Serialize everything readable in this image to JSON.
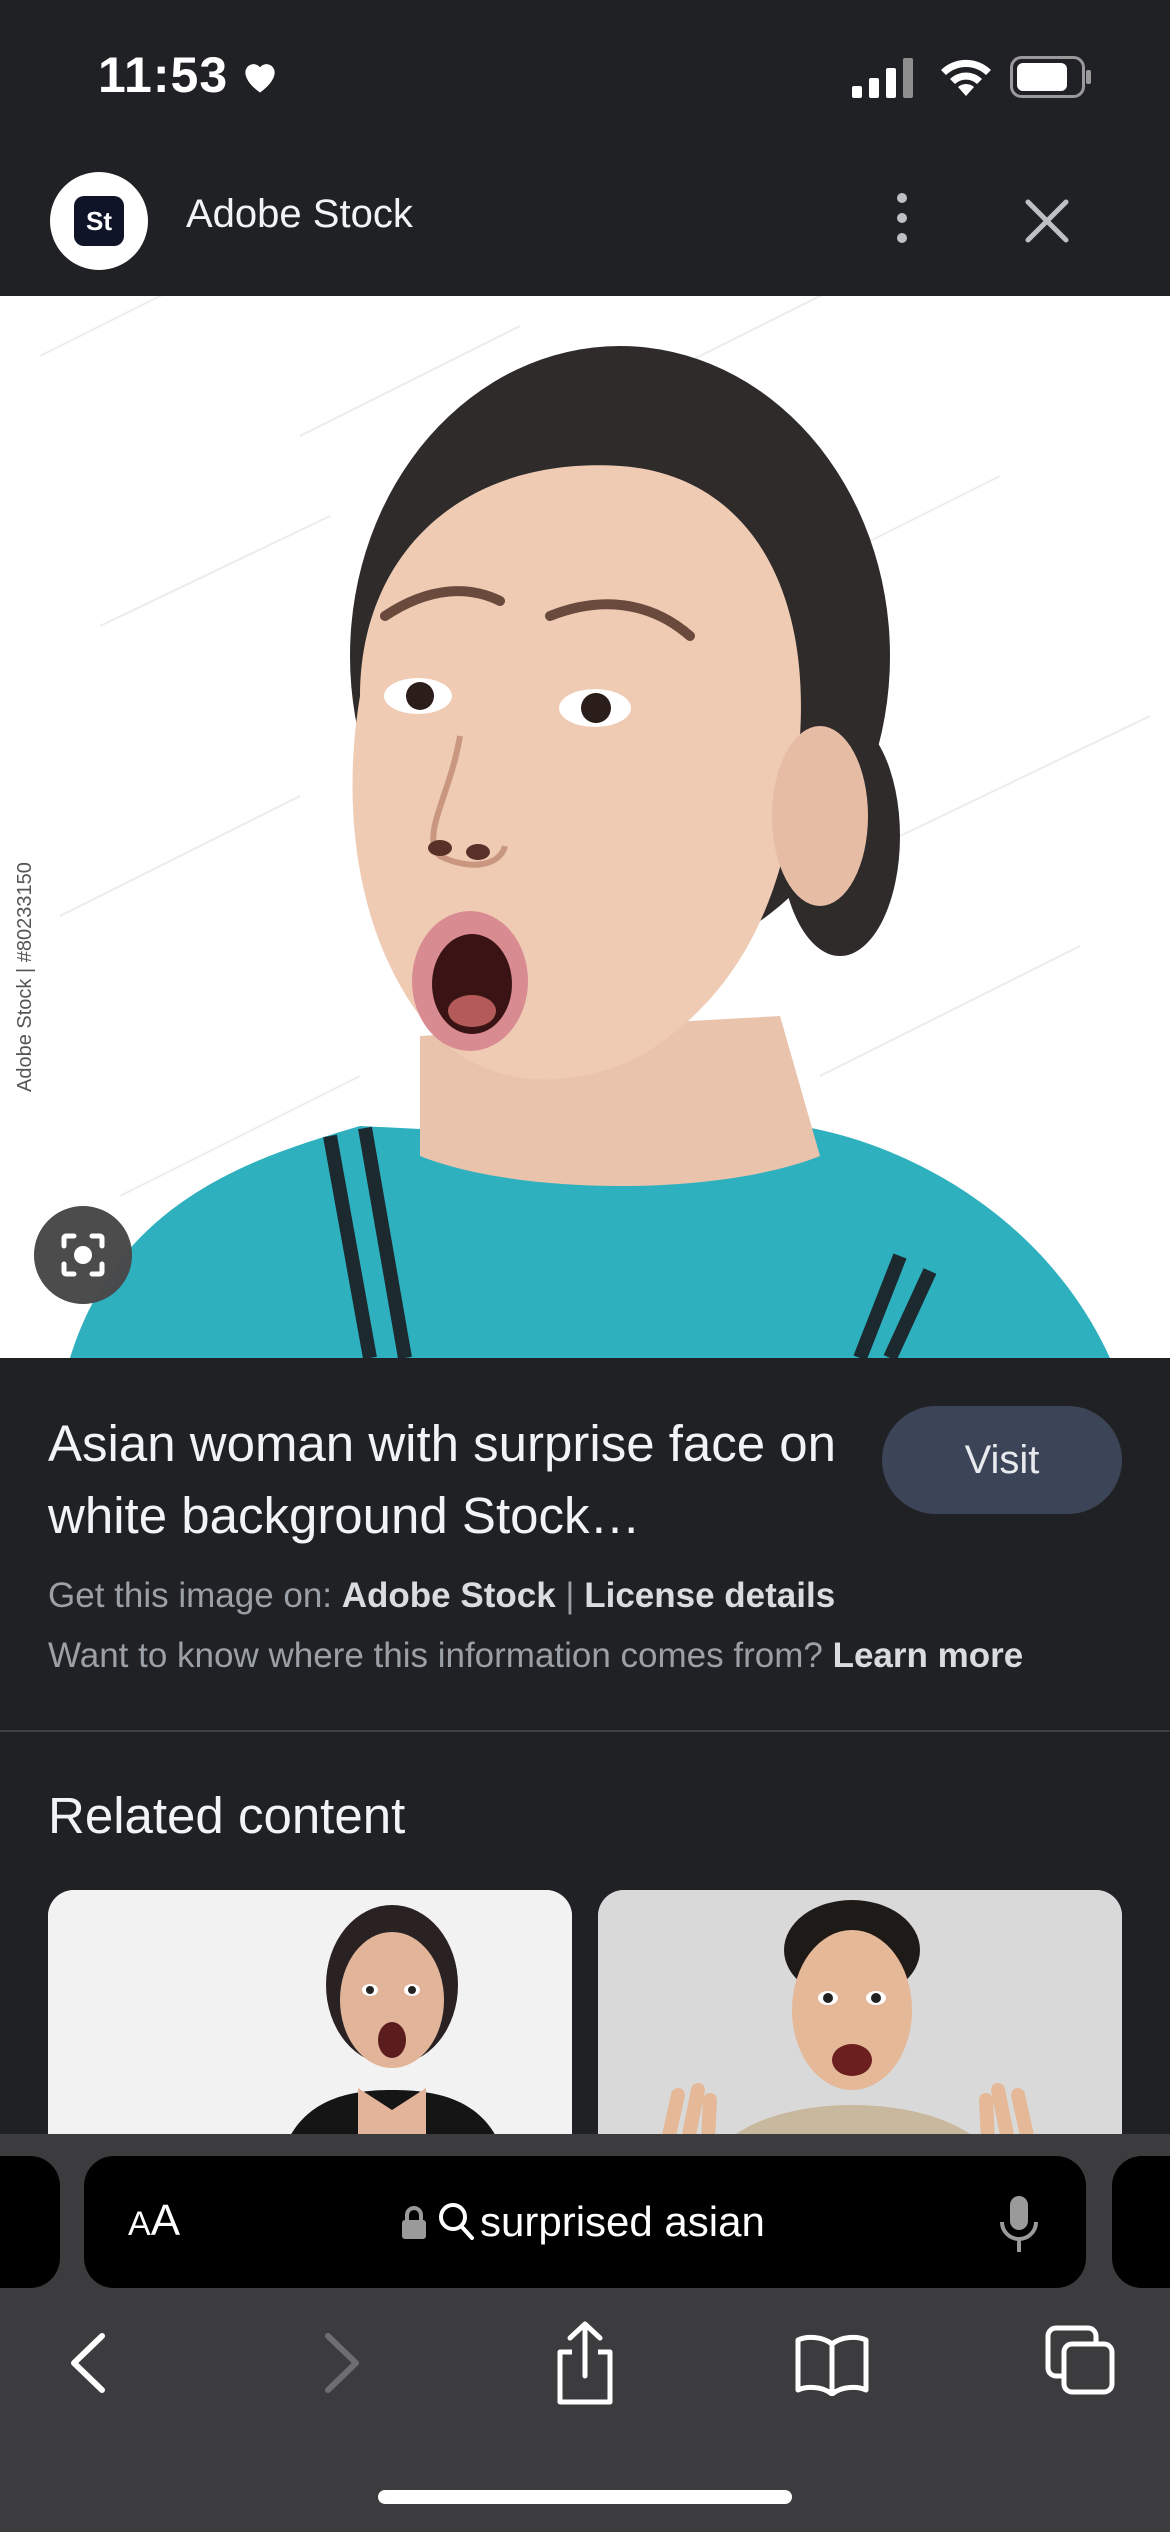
{
  "status_bar": {
    "time": "11:53"
  },
  "header": {
    "logo_text": "St",
    "site_name": "Adobe Stock"
  },
  "image": {
    "watermark": "Adobe Stock | #80233150"
  },
  "result": {
    "title": "Asian woman with surprise face on white background Stock…",
    "visit_label": "Visit",
    "source_prefix": "Get this image on: ",
    "source_name": "Adobe Stock",
    "separator": " | ",
    "license_label": "License details",
    "info_question": "Want to know where this information comes from? ",
    "learn_more_label": "Learn more"
  },
  "related": {
    "title": "Related content"
  },
  "browser": {
    "aa_small": "A",
    "aa_large": "A",
    "url_text": "surprised asian"
  }
}
